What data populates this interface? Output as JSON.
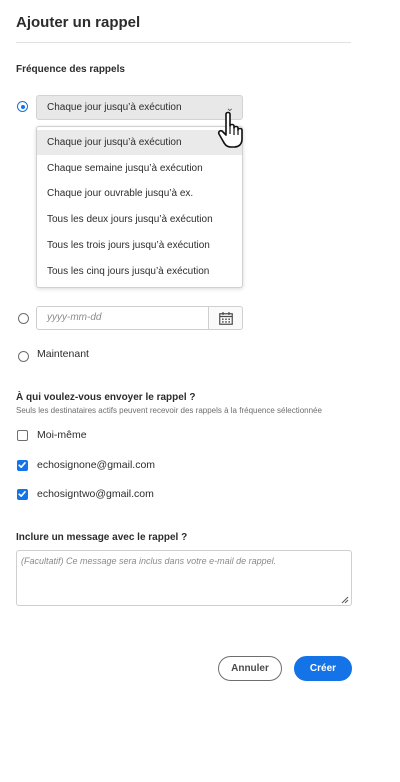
{
  "dialog": {
    "title": "Ajouter un rappel"
  },
  "frequency": {
    "label": "Fréquence des rappels",
    "selected": "Chaque jour jusqu’à exécution",
    "options": [
      "Chaque jour jusqu’à exécution",
      "Chaque semaine jusqu’à exécution",
      "Chaque jour ouvrable jusqu’à ex.",
      "Tous les deux jours jusqu’à exécution",
      "Tous les trois jours jusqu’à exécution",
      "Tous les cinq jours jusqu’à exécution"
    ],
    "date_placeholder": "yyyy-mm-dd",
    "now_label": "Maintenant"
  },
  "recipients": {
    "label": "À qui voulez-vous envoyer le rappel ?",
    "hint": "Seuls les destinataires actifs peuvent recevoir des rappels à la fréquence sélectionnée",
    "items": [
      {
        "label": "Moi-même",
        "checked": false
      },
      {
        "label": "echosignone@gmail.com",
        "checked": true
      },
      {
        "label": "echosigntwo@gmail.com",
        "checked": true
      }
    ]
  },
  "message": {
    "label": "Inclure un message avec le rappel ?",
    "placeholder": "(Facultatif) Ce message sera inclus dans votre e-mail de rappel."
  },
  "buttons": {
    "cancel": "Annuler",
    "create": "Créer"
  },
  "colors": {
    "accent": "#1473e6"
  }
}
